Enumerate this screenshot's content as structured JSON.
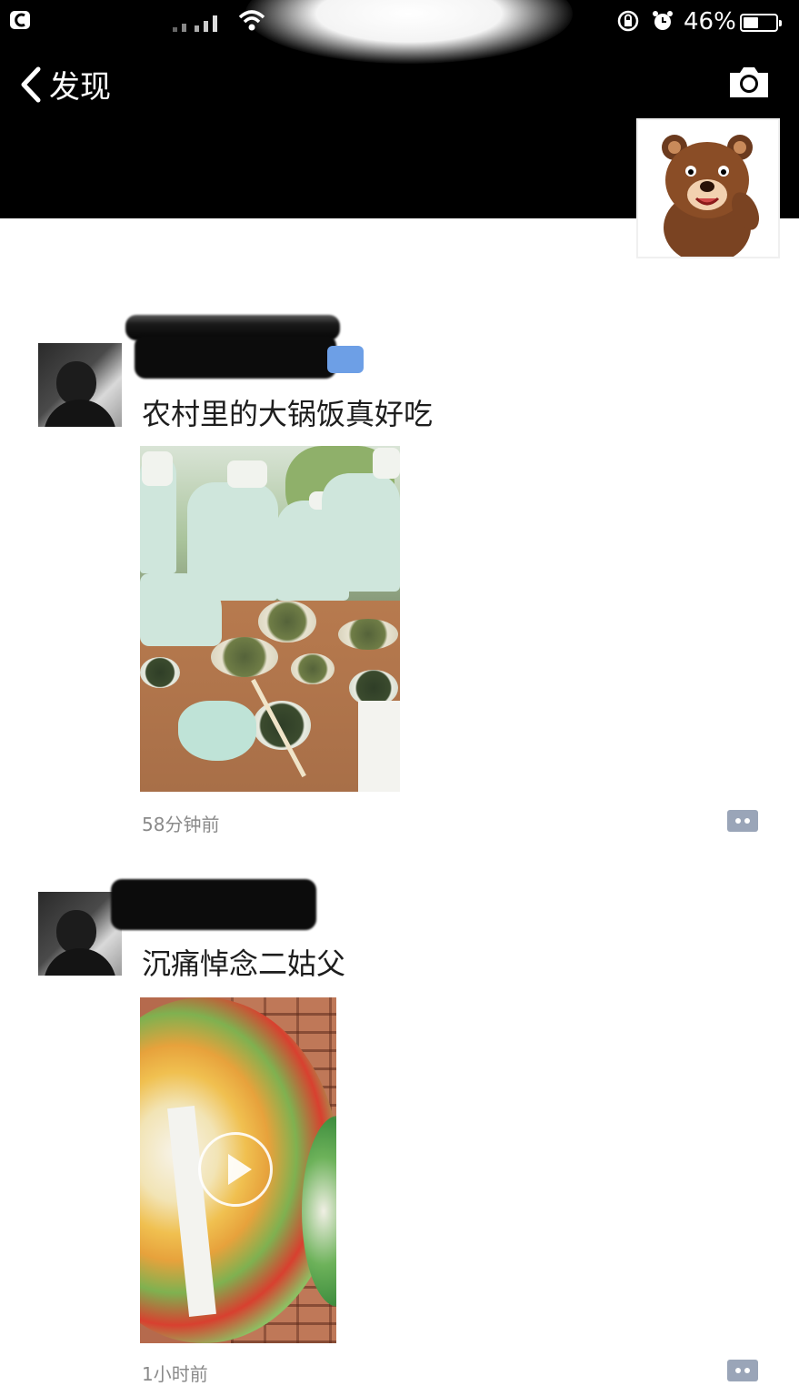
{
  "status_bar": {
    "battery_percent": "46%",
    "battery_level": 0.46
  },
  "nav": {
    "back_label": "发现"
  },
  "posts": [
    {
      "text": "农村里的大锅饭真好吃",
      "time": "58分钟前"
    },
    {
      "text": "沉痛悼念二姑父",
      "time": "1小时前"
    }
  ],
  "icons": {
    "back": "chevron-left-icon",
    "camera": "camera-icon",
    "comment": "comment-icon",
    "play": "play-icon",
    "wifi": "wifi-icon",
    "signal": "signal-icon",
    "lock": "orientation-lock-icon",
    "alarm": "alarm-icon",
    "battery": "battery-icon"
  }
}
